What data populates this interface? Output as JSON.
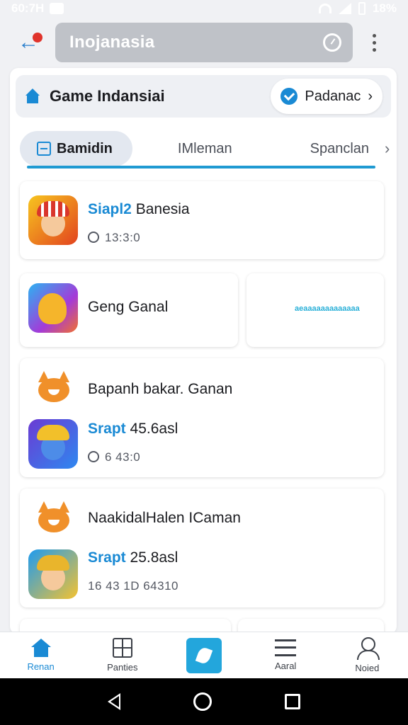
{
  "status_bar": {
    "time": "60:7H",
    "battery": "18%"
  },
  "app_bar": {
    "search_text": "Inojanasia"
  },
  "header": {
    "title": "Game Indansiai",
    "chip_label": "Padanac",
    "chip_chevron": "›"
  },
  "tabs": [
    {
      "label": "Bamidin"
    },
    {
      "label": "IMleman"
    },
    {
      "label": "Spanclan"
    }
  ],
  "tabs_chevron": "›",
  "cards": [
    {
      "accent": "Siapl2",
      "title": "Banesia",
      "meta": "13:3:0"
    },
    {
      "title": "Geng Ganal",
      "promo": "aeaaaaaaaaaaaaa"
    },
    {
      "heading": "Bapanh bakar. Ganan",
      "accent": "Srapt",
      "title": "45.6asl",
      "meta": "6 43:0"
    },
    {
      "heading": "NaakidalHalen ICaman",
      "accent": "Srapt",
      "title": "25.8asl",
      "meta": "16 43 1D  64310"
    }
  ],
  "bottom_nav": [
    {
      "label": "Renan"
    },
    {
      "label": "Panties"
    },
    {
      "label": ""
    },
    {
      "label": "Aaral"
    },
    {
      "label": "Noied"
    }
  ]
}
